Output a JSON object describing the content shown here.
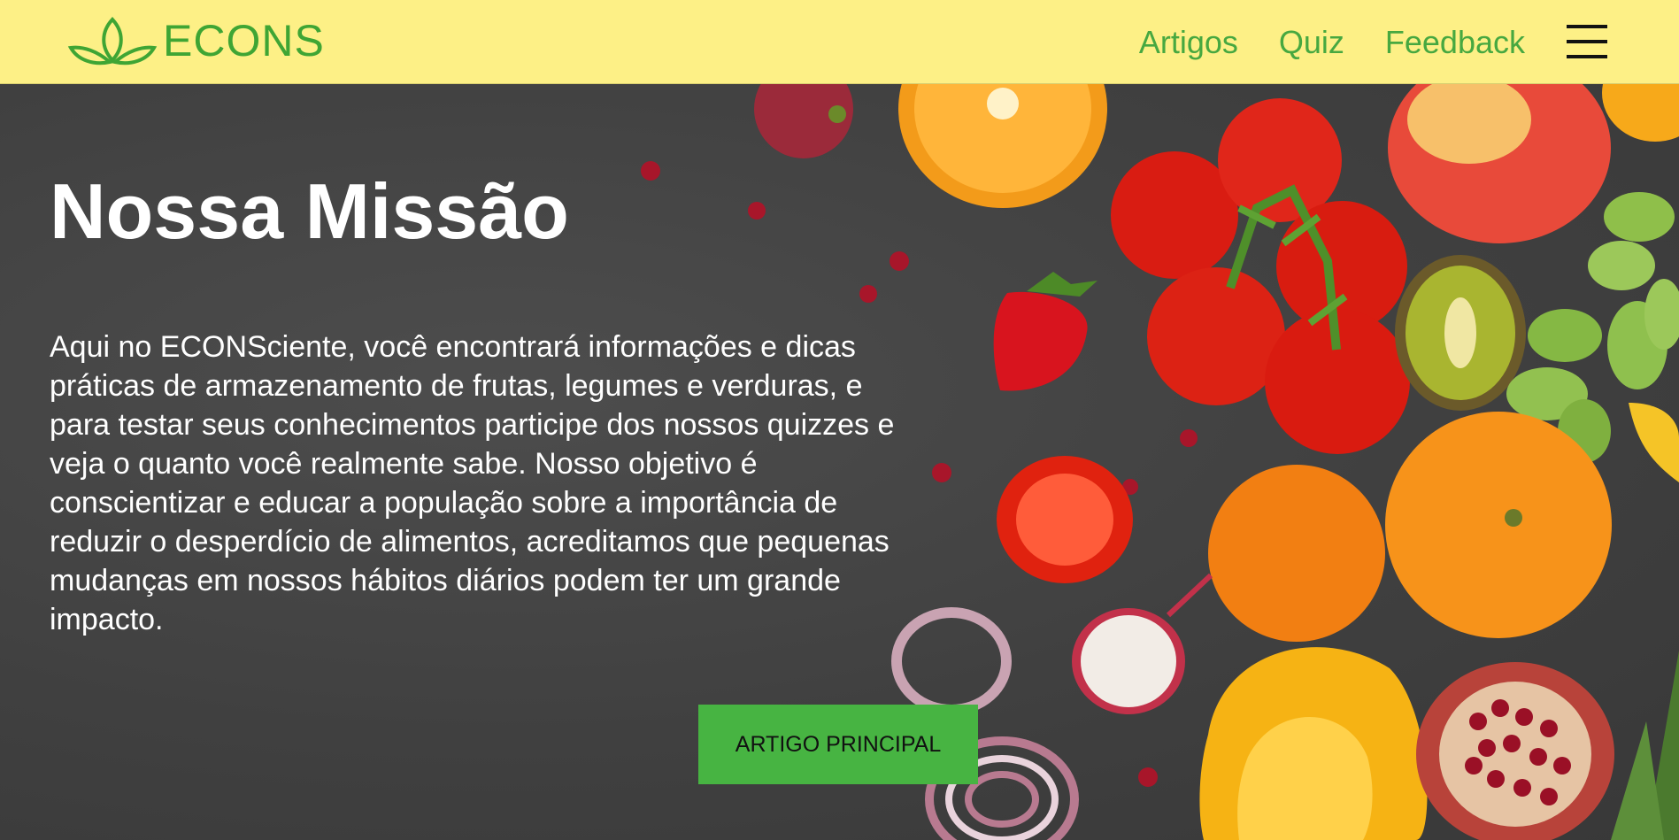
{
  "brand": {
    "name": "ECONS"
  },
  "nav": {
    "links": [
      "Artigos",
      "Quiz",
      "Feedback"
    ],
    "menu_icon": "hamburger-menu-icon"
  },
  "hero": {
    "title": "Nossa Missão",
    "text": "Aqui no ECONSciente, você encontrará informações e dicas\npráticas de armazenamento de frutas, legumes e verduras, e\npara testar seus conhecimentos participe dos nossos quizzes e\nveja o quanto você realmente sabe. Nosso objetivo é\nconscientizar e educar a população sobre a importância de\nreduzir o desperdício de alimentos, acreditamos que pequenas\nmudanças em nossos hábitos diários podem ter um grande\nimpacto.",
    "cta_label": "ARTIGO PRINCIPAL",
    "background": "fruits-and-vegetables-photo"
  },
  "colors": {
    "navbar_bg": "#fdf086",
    "brand_green": "#3fa534",
    "cta_green": "#47b442",
    "hero_bg": "#444444"
  }
}
